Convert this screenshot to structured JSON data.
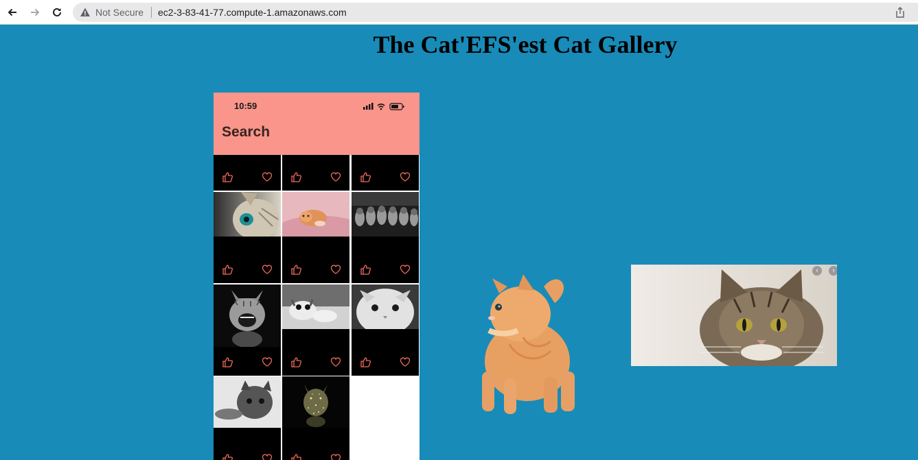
{
  "browser": {
    "security_label": "Not Secure",
    "url": "ec2-3-83-41-77.compute-1.amazonaws.com",
    "icons": [
      "back-icon",
      "forward-icon",
      "reload-icon",
      "warning-icon",
      "share-icon"
    ]
  },
  "page": {
    "title": "The Cat'EFS'est Cat Gallery",
    "background": "#188bb8"
  },
  "phone": {
    "time": "10:59",
    "header_title": "Search",
    "header_color": "#f9958a",
    "action_color": "#f26b5b",
    "cells": [
      {
        "kind": "blank"
      },
      {
        "kind": "blank"
      },
      {
        "kind": "blank"
      },
      {
        "kind": "tabby-closeup"
      },
      {
        "kind": "orange-kitten-pink"
      },
      {
        "kind": "kitten-row"
      },
      {
        "kind": "laughing-cat"
      },
      {
        "kind": "kitten-bw"
      },
      {
        "kind": "white-cat"
      },
      {
        "kind": "gray-kitten"
      },
      {
        "kind": "glitter-cat"
      }
    ]
  },
  "carousel": {
    "prev_icon": "chevron-left-icon",
    "next_icon": "chevron-right-icon"
  }
}
